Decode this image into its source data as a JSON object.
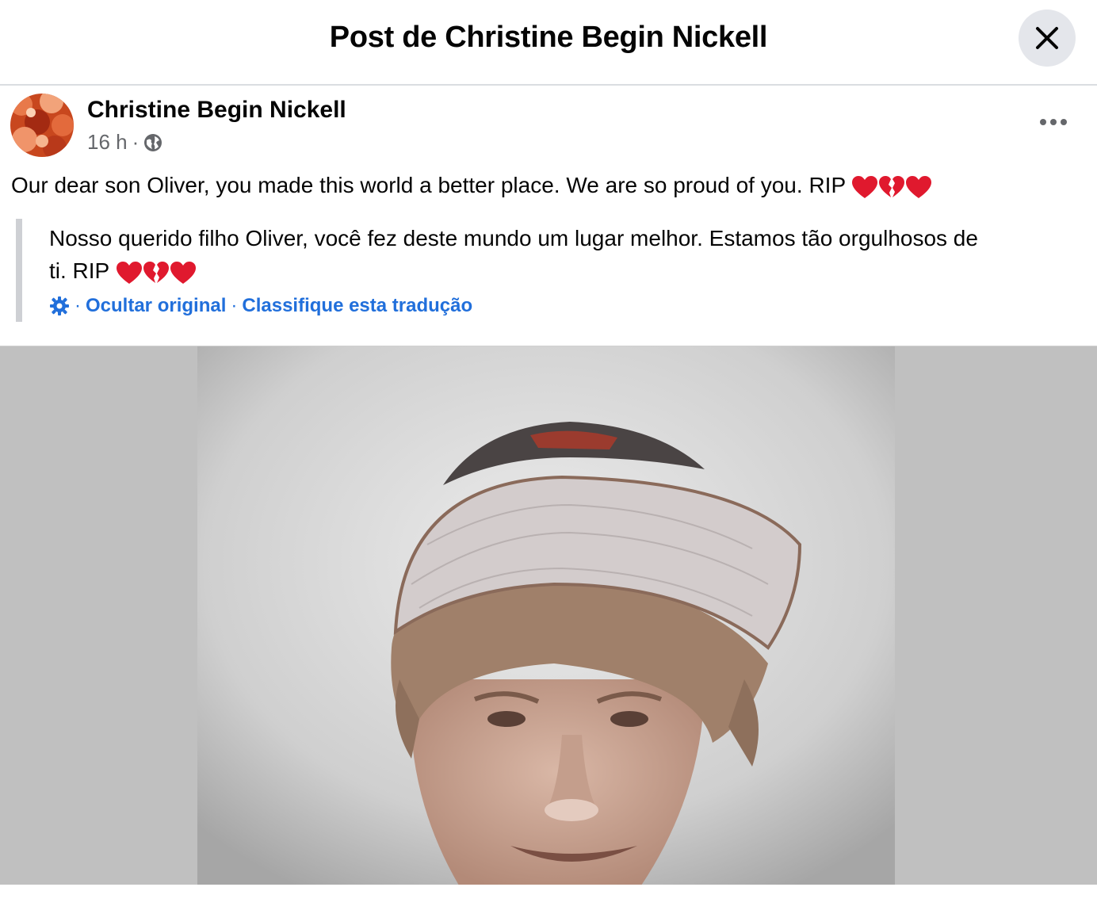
{
  "header": {
    "title": "Post de Christine Begin Nickell",
    "close_icon": "close-icon"
  },
  "post": {
    "author": "Christine Begin Nickell",
    "time": "16 h",
    "separator": "·",
    "audience_icon": "globe-icon",
    "more_icon": "more-horizontal-icon",
    "text": "Our dear son Oliver, you made this world a better place. We are so proud of you. RIP",
    "emojis": [
      "red-heart",
      "broken-heart",
      "red-heart"
    ]
  },
  "translation": {
    "line1": "Nosso querido filho Oliver, você fez deste mundo um lugar melhor. Estamos tão orgulhosos de",
    "line2": "ti. RIP",
    "settings_icon": "gear-icon",
    "sep": "·",
    "hide_original": "Ocultar original",
    "rate_translation": "Classifique esta tradução"
  },
  "colors": {
    "link": "#216fdb",
    "secondary_text": "#65676b",
    "close_bg": "#e4e6eb",
    "photo_bg": "#c0c0c0",
    "heart": "#e0192e"
  }
}
